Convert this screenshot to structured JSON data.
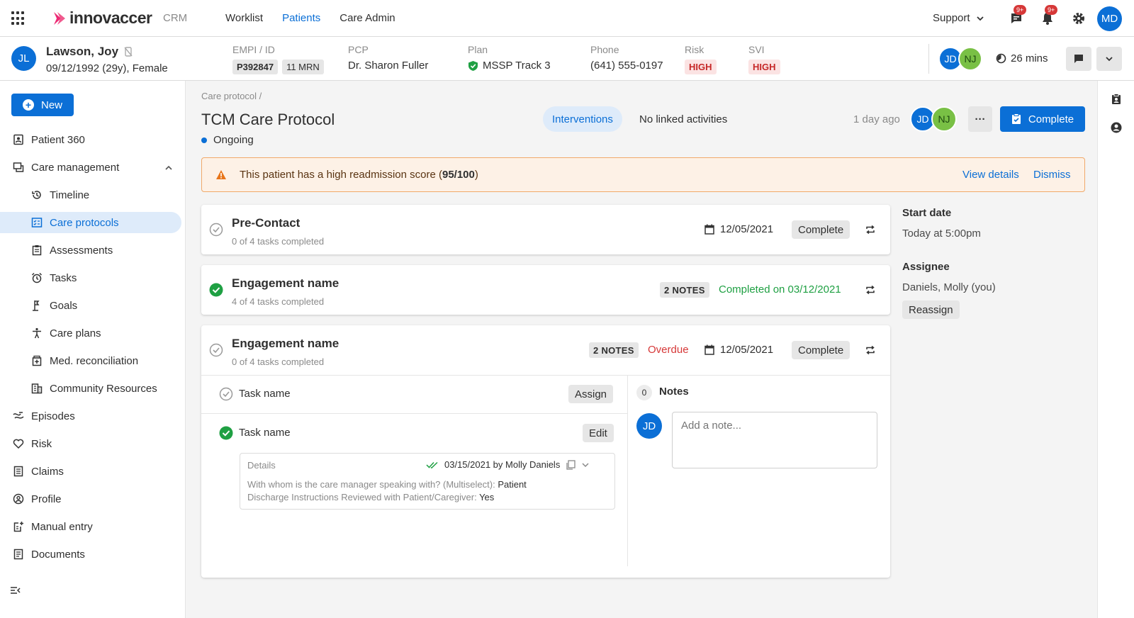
{
  "nav": {
    "crm": "CRM",
    "tabs": [
      "Worklist",
      "Patients",
      "Care Admin"
    ],
    "support": "Support",
    "msg_badge": "9+",
    "bell_badge": "9+",
    "user_initials": "MD"
  },
  "patient": {
    "initials": "JL",
    "name": "Lawson, Joy",
    "dob": "09/12/1992 (29y), Female",
    "empi_label": "EMPI / ID",
    "empi": "P392847",
    "mrn": "11 MRN",
    "pcp_label": "PCP",
    "pcp": "Dr. Sharon Fuller",
    "plan_label": "Plan",
    "plan": "MSSP Track 3",
    "phone_label": "Phone",
    "phone": "(641) 555-0197",
    "risk_label": "Risk",
    "risk": "HIGH",
    "svi_label": "SVI",
    "svi": "HIGH",
    "care_team": [
      "JD",
      "NJ"
    ],
    "timer": "26 mins"
  },
  "sidebar": {
    "new_label": "New",
    "items": [
      {
        "label": "Patient 360",
        "level": 0
      },
      {
        "label": "Care management",
        "level": 0
      },
      {
        "label": "Timeline",
        "level": 1
      },
      {
        "label": "Care protocols",
        "level": 1
      },
      {
        "label": "Assessments",
        "level": 1
      },
      {
        "label": "Tasks",
        "level": 1
      },
      {
        "label": "Goals",
        "level": 1
      },
      {
        "label": "Care plans",
        "level": 1
      },
      {
        "label": "Med. reconciliation",
        "level": 1
      },
      {
        "label": "Community Resources",
        "level": 1
      },
      {
        "label": "Episodes",
        "level": 0
      },
      {
        "label": "Risk",
        "level": 0
      },
      {
        "label": "Claims",
        "level": 0
      },
      {
        "label": "Profile",
        "level": 0
      },
      {
        "label": "Manual entry",
        "level": 0
      },
      {
        "label": "Documents",
        "level": 0
      }
    ]
  },
  "protocol": {
    "breadcrumb": "Care protocol /",
    "title": "TCM Care Protocol",
    "status": "Ongoing",
    "interventions": "Interventions",
    "linked": "No linked activities",
    "updated": "1 day ago",
    "avatars": [
      "JD",
      "NJ"
    ],
    "more": "···",
    "complete_label": "Complete"
  },
  "alert": {
    "text_pre": "This patient has a high readmission score (",
    "score": "95/100",
    "text_post": ")",
    "view_details": "View details",
    "dismiss": "Dismiss"
  },
  "cards": [
    {
      "title": "Pre-Contact",
      "sub": "0 of 4 tasks completed",
      "date": "12/05/2021",
      "action": "Complete"
    },
    {
      "title": "Engagement name",
      "sub": "4 of 4 tasks completed",
      "notes": "2 NOTES",
      "completed": "Completed on 03/12/2021"
    },
    {
      "title": "Engagement name",
      "sub": "0 of 4 tasks completed",
      "notes": "2 NOTES",
      "overdue": "Overdue",
      "date": "12/05/2021",
      "action": "Complete"
    }
  ],
  "tasks": [
    {
      "name": "Task name",
      "action": "Assign"
    },
    {
      "name": "Task name",
      "action": "Edit"
    }
  ],
  "details": {
    "label": "Details",
    "meta": "03/15/2021 by Molly Daniels",
    "q1": "With whom is the care manager speaking with? (Multiselect): ",
    "a1": "Patient",
    "q2": "Discharge Instructions Reviewed with Patient/Caregiver: ",
    "a2": "Yes"
  },
  "notes": {
    "count": "0",
    "title": "Notes",
    "author_initials": "JD",
    "placeholder": "Add a note..."
  },
  "right_panel": {
    "start_label": "Start date",
    "start_value": "Today at 5:00pm",
    "assignee_label": "Assignee",
    "assignee_value": "Daniels, Molly (you)",
    "reassign": "Reassign"
  },
  "colors": {
    "primary": "#0b6fd6",
    "success": "#1fa043",
    "danger": "#d63838",
    "warning_bg": "#fdf1e6"
  }
}
